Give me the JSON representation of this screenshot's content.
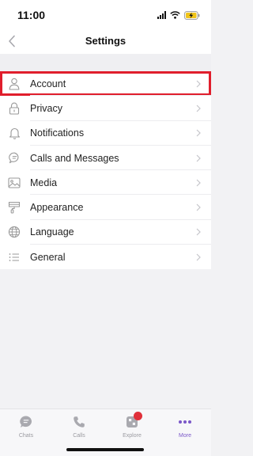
{
  "status_bar": {
    "time": "11:00"
  },
  "nav": {
    "title": "Settings",
    "back_icon": "chevron-left-icon"
  },
  "settings_items": [
    {
      "label": "Account",
      "icon": "person-icon",
      "highlighted": true
    },
    {
      "label": "Privacy",
      "icon": "lock-icon"
    },
    {
      "label": "Notifications",
      "icon": "bell-icon"
    },
    {
      "label": "Calls and Messages",
      "icon": "chat-bubble-icon"
    },
    {
      "label": "Media",
      "icon": "image-icon"
    },
    {
      "label": "Appearance",
      "icon": "paint-bucket-icon"
    },
    {
      "label": "Language",
      "icon": "globe-icon"
    },
    {
      "label": "General",
      "icon": "list-icon"
    }
  ],
  "tabs": [
    {
      "label": "Chats",
      "icon": "chat-icon"
    },
    {
      "label": "Calls",
      "icon": "phone-icon"
    },
    {
      "label": "Explore",
      "icon": "explore-icon",
      "has_badge": true
    },
    {
      "label": "More",
      "icon": "more-icon",
      "active": true
    }
  ],
  "colors": {
    "accent": "#7a57c8",
    "highlight": "#e01e2c",
    "badge": "#e0303a"
  }
}
